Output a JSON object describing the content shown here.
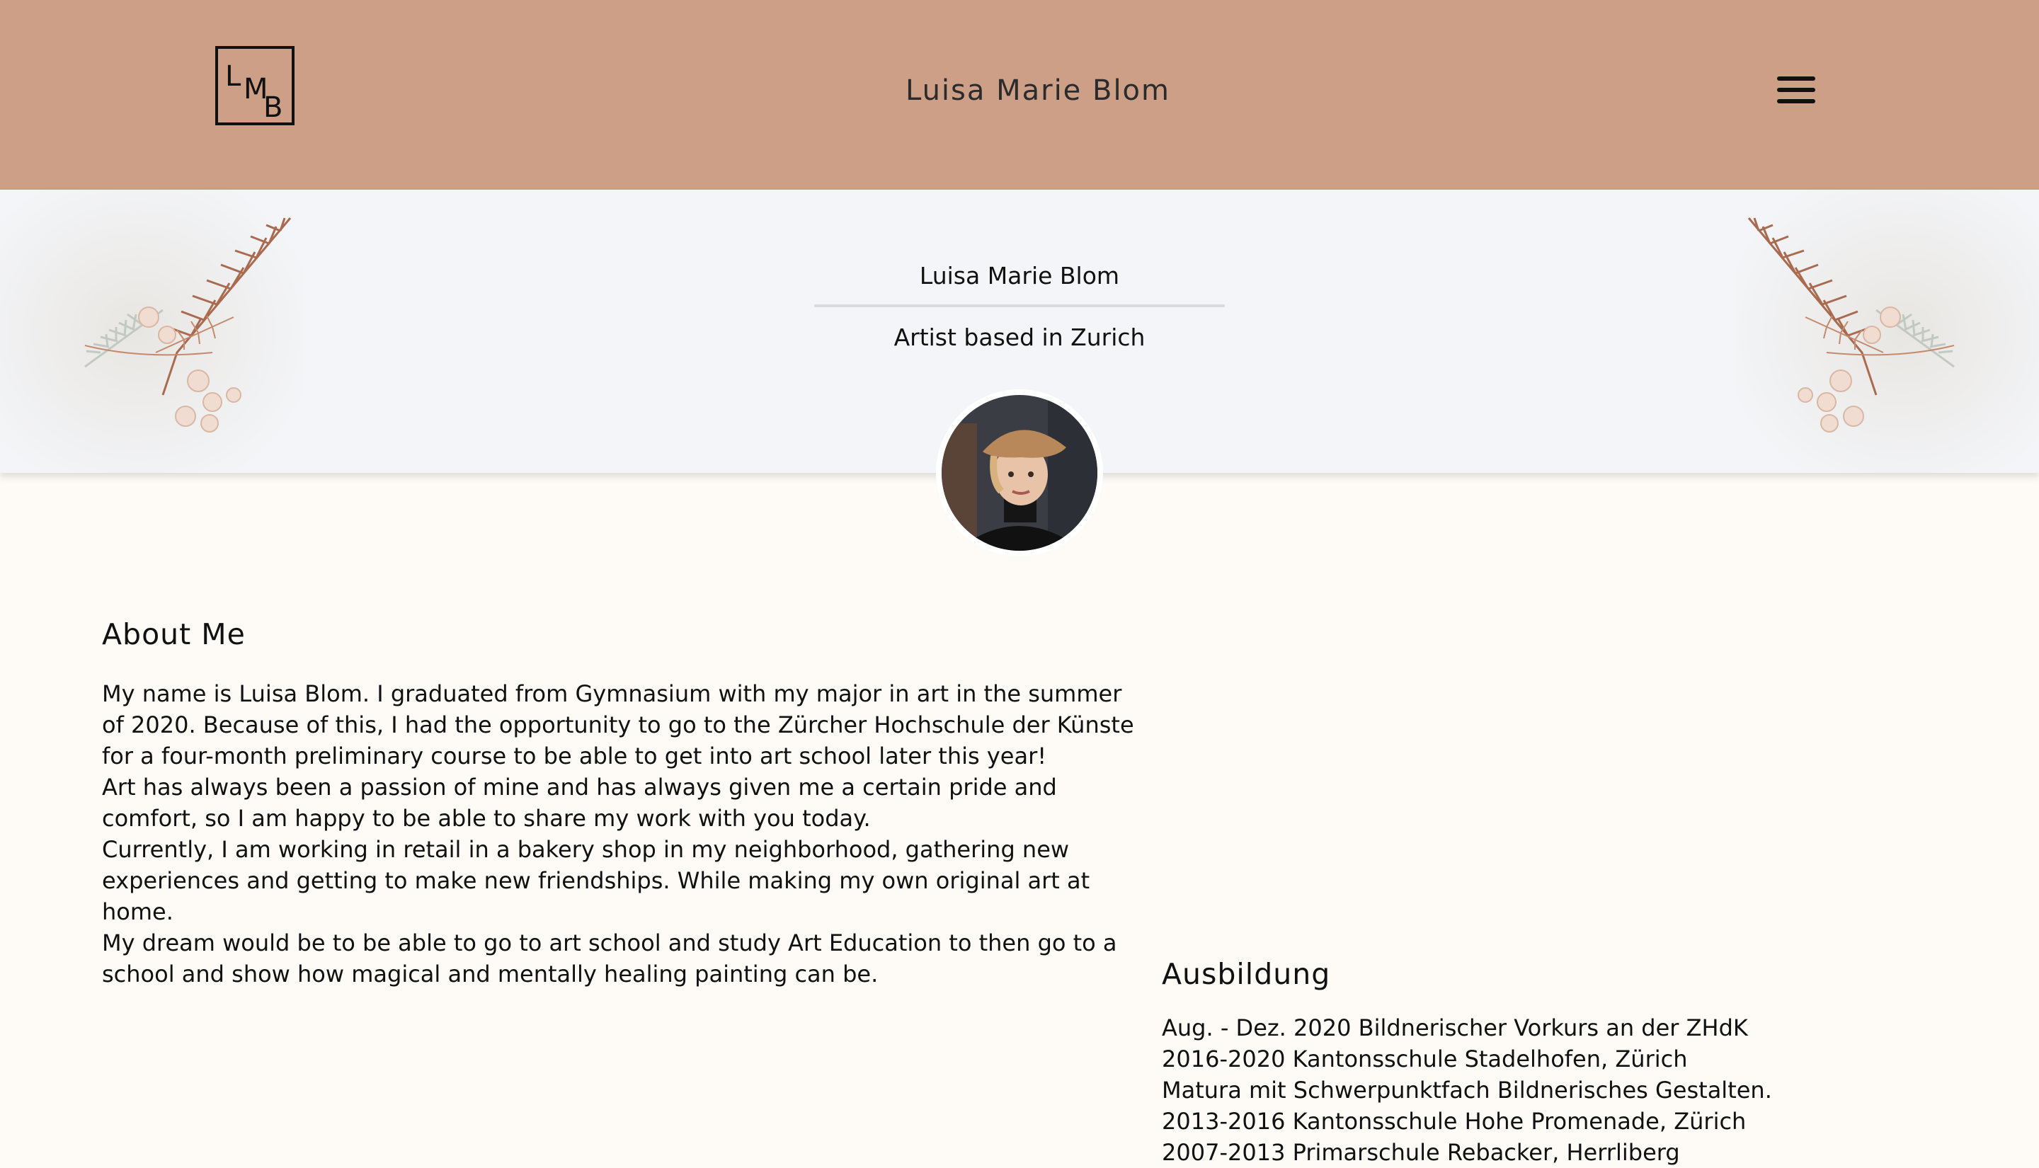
{
  "header": {
    "logo_letters": [
      "L",
      "M",
      "B"
    ],
    "title": "Luisa Marie Blom",
    "menu_icon": "hamburger-menu-icon"
  },
  "hero": {
    "name": "Luisa Marie Blom",
    "subtitle": "Artist based in Zurich",
    "decoration_icon": "fern-bouquet",
    "avatar_icon": "profile-photo"
  },
  "about": {
    "title": "About Me",
    "paragraphs": [
      "My name is Luisa Blom. I graduated from Gymnasium with my major in art in the summer of 2020. Because of this, I had the opportunity to go to the Zürcher Hochschule der Künste for a four-month preliminary course to be able to get into art school later this year!",
      "Art has always been a passion of mine and has always given me a certain pride and comfort, so I am happy to be able to share my work with you today.",
      "Currently, I am working in retail in a bakery shop in my neighborhood, gathering new experiences and getting to make new friendships. While making my own original art at home.",
      "My dream would be to be able to go to art school and study Art Education to then go to a school and show how magical and mentally healing painting can be."
    ]
  },
  "education": {
    "title": "Ausbildung",
    "items": [
      "Aug. - Dez. 2020 Bildnerischer Vorkurs an der ZHdK",
      "2016-2020 Kantonsschule Stadelhofen, Zürich",
      "Matura mit Schwerpunktfach Bildnerisches Gestalten.",
      "2013-2016 Kantonsschule Hohe Promenade, Zürich",
      "2007-2013 Primarschule Rebacker, Herrliberg"
    ]
  },
  "colors": {
    "header_bg": "#cd9f87",
    "hero_bg": "#f4f5f8",
    "page_bg": "#fefbf7",
    "text": "#111111"
  }
}
